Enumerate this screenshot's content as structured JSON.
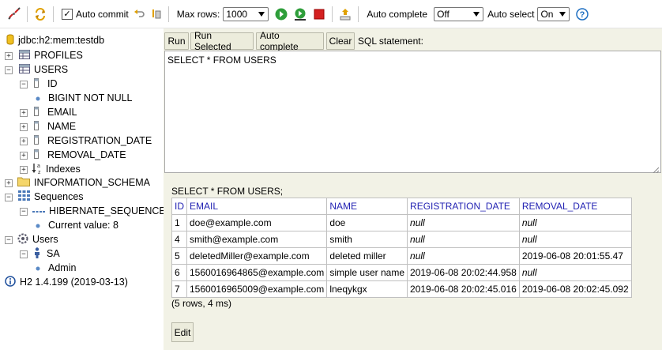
{
  "toolbar": {
    "auto_commit_label": "Auto commit",
    "auto_commit_checked": true,
    "max_rows_label": "Max rows:",
    "max_rows_value": "1000",
    "auto_complete_label": "Auto complete",
    "auto_complete_value": "Off",
    "auto_select_label": "Auto select",
    "auto_select_value": "On",
    "help_glyph": "?"
  },
  "tree": {
    "connection": "jdbc:h2:mem:testdb",
    "profiles": "PROFILES",
    "users": "USERS",
    "col_id": "ID",
    "col_id_type": "BIGINT NOT NULL",
    "col_email": "EMAIL",
    "col_name": "NAME",
    "col_registration_date": "REGISTRATION_DATE",
    "col_removal_date": "REMOVAL_DATE",
    "indexes": "Indexes",
    "information_schema": "INFORMATION_SCHEMA",
    "sequences": "Sequences",
    "hibernate_sequence": "HIBERNATE_SEQUENCE",
    "current_value": "Current value: 8",
    "users_node": "Users",
    "user_sa": "SA",
    "user_admin": "Admin",
    "version": "H2 1.4.199 (2019-03-13)"
  },
  "buttons": {
    "run": "Run",
    "run_selected": "Run Selected",
    "auto_complete": "Auto complete",
    "clear": "Clear",
    "sql_statement_label": "SQL statement:",
    "edit": "Edit"
  },
  "editor": {
    "query": "SELECT * FROM USERS"
  },
  "result": {
    "query_echo": "SELECT * FROM USERS;",
    "headers": [
      "ID",
      "EMAIL",
      "NAME",
      "REGISTRATION_DATE",
      "REMOVAL_DATE"
    ],
    "rows": [
      [
        "1",
        "doe@example.com",
        "doe",
        "null",
        "null"
      ],
      [
        "4",
        "smith@example.com",
        "smith",
        "null",
        "null"
      ],
      [
        "5",
        "deletedMiller@example.com",
        "deleted miller",
        "null",
        "2019-06-08 20:01:55.47"
      ],
      [
        "6",
        "1560016964865@example.com",
        "simple user name",
        "2019-06-08 20:02:44.958",
        "null"
      ],
      [
        "7",
        "1560016965009@example.com",
        "lneqykgx",
        "2019-06-08 20:02:45.016",
        "2019-06-08 20:02:45.092"
      ]
    ],
    "summary": "(5 rows, 4 ms)"
  },
  "colors": {
    "main_bg": "#f2f2e6",
    "header_text": "#2323b3",
    "run_green": "#2e9e3a",
    "stop_red": "#d42020",
    "help_blue": "#1e6fc2"
  }
}
